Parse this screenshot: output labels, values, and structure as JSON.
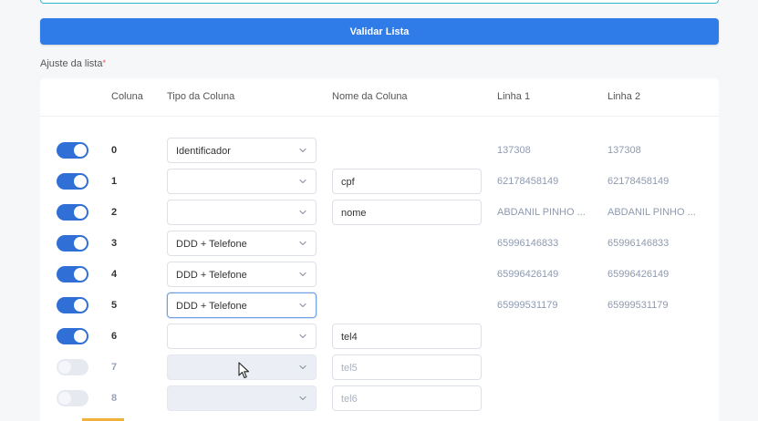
{
  "validate_button": {
    "label": "Validar Lista"
  },
  "section": {
    "label": "Ajuste da lista",
    "required_mark": "*"
  },
  "table": {
    "headers": {
      "coluna": "Coluna",
      "tipo": "Tipo da Coluna",
      "nome": "Nome da Coluna",
      "linha1": "Linha 1",
      "linha2": "Linha 2"
    },
    "rows": [
      {
        "enabled": true,
        "index": "0",
        "tipo": "Identificador",
        "nome": null,
        "linha1": "137308",
        "linha2": "137308"
      },
      {
        "enabled": true,
        "index": "1",
        "tipo": "",
        "nome": "cpf",
        "linha1": "62178458149",
        "linha2": "62178458149"
      },
      {
        "enabled": true,
        "index": "2",
        "tipo": "",
        "nome": "nome",
        "linha1": "ABDANIL PINHO ...",
        "linha2": "ABDANIL PINHO ..."
      },
      {
        "enabled": true,
        "index": "3",
        "tipo": "DDD + Telefone",
        "nome": null,
        "linha1": "65996146833",
        "linha2": "65996146833"
      },
      {
        "enabled": true,
        "index": "4",
        "tipo": "DDD + Telefone",
        "nome": null,
        "linha1": "65996426149",
        "linha2": "65996426149"
      },
      {
        "enabled": true,
        "index": "5",
        "tipo": "DDD + Telefone",
        "nome": null,
        "linha1": "65999531179",
        "linha2": "65999531179"
      },
      {
        "enabled": true,
        "index": "6",
        "tipo": "",
        "nome": "tel4",
        "linha1": "",
        "linha2": ""
      },
      {
        "enabled": false,
        "index": "7",
        "tipo": "",
        "nome": "tel5",
        "linha1": "",
        "linha2": ""
      },
      {
        "enabled": false,
        "index": "8",
        "tipo": "",
        "nome": "tel6",
        "linha1": "",
        "linha2": ""
      }
    ]
  },
  "icons": {
    "chevron": "chevron-down-icon",
    "cursor": "mouse-cursor-icon"
  },
  "colors": {
    "accent": "#2f7be8",
    "toggle_on": "#2f6fd6",
    "required": "#e24b4b"
  }
}
